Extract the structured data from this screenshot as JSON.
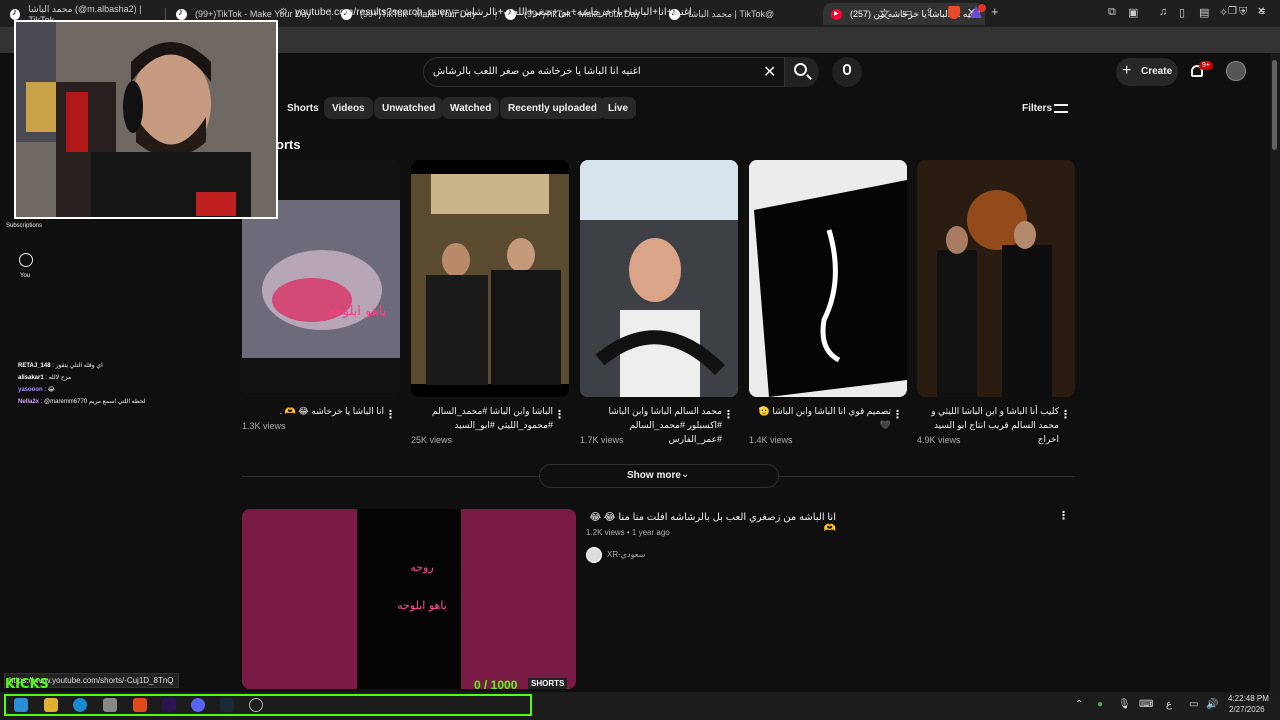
{
  "browser": {
    "tabs": [
      {
        "label": "محمد الباشا (@m.albasha2) | TikTok",
        "icon": "tiktok-icon"
      },
      {
        "label": "(99+)TikTok - Make Your Day",
        "icon": "tiktok-icon"
      },
      {
        "label": "(99+)TikTok - Make Your Day",
        "icon": "tiktok-icon"
      },
      {
        "label": "(99+)TikTok - Make Your Day",
        "icon": "tiktok-icon"
      },
      {
        "label": "محمد الباشا | TikTok@",
        "icon": "tiktok-icon"
      },
      {
        "label": "(257) اغنيه انا الباشا يا خرخاشه من",
        "icon": "youtube-icon",
        "active": true
      }
    ],
    "url": "youtube.com/results?search_query=اغنيه+انا+الباشا+يا+خرخاشه+من+صغر+اللعب+بالرشاش",
    "window_controls": [
      "─",
      "❐",
      "✕"
    ]
  },
  "youtube": {
    "search": {
      "value": "اغنيه انا الباشا يا خرخاشه من صغر اللعب بالرشاش"
    },
    "create_label": "Create",
    "notif_badge": "9+",
    "chips": [
      "Shorts",
      "Videos",
      "Unwatched",
      "Watched",
      "Recently uploaded",
      "Live"
    ],
    "filters_label": "Filters",
    "shorts_heading": "orts",
    "shorts": [
      {
        "title": "انا الباشا يا خرخاشه 😂 🫶 .",
        "views": "1.3K views"
      },
      {
        "title": "الباشا وابن الباشا #محمد_السالم #محمود_الليثي #ابو_السيد",
        "views": "25K views"
      },
      {
        "title": "محمد السالم الباشا وابن الباشا #اكسبلور #محمد_السالم #عمر_الفارس",
        "views": "1.7K views"
      },
      {
        "title": "تصميم قوي انا الباشا وابن الباشا 🫡🖤",
        "views": "1.4K views"
      },
      {
        "title": "كليب أنا الباشا و ابن الباشا الليثي و محمد السالم قريب انتاج ابو السيد اخراج",
        "views": "4.9K views"
      }
    ],
    "show_more": "Show more",
    "video": {
      "title": "انا الباشه من زصغري العب بل بالرشاشه افلت منا منا 😂 😂 🫶",
      "meta": "1.2K views • 1 year ago",
      "channel": "XR-سعودي",
      "thumb_text_top": "روحه",
      "thumb_text_mid": "ياهو ابلوحه"
    },
    "short_overlay_text": "ياهو ابلوحه",
    "sidebar": {
      "subscriptions": "Subscriptions",
      "you": "You"
    }
  },
  "chat": [
    {
      "user": "RETAJ_148",
      "msg": "اي وقله التلي يتقوز",
      "color": "#ffffff"
    },
    {
      "user": "alisakar1",
      "msg": "مزح لالله",
      "color": "#ffffff"
    },
    {
      "user": "yasooon",
      "msg": "😂",
      "color": "#a58cff"
    },
    {
      "user": "Nella2x",
      "msg": "@maremm6770 لحظه اللتي اسمع مريم",
      "color": "#d9a0ff"
    }
  ],
  "overlay": {
    "status_url": "https://www.youtube.com/shorts/-Cuj1D_8TnQ",
    "kicks_label": "KICKS",
    "kicks_count": "0 / 1000",
    "shorts_badge": "SHORTS"
  },
  "taskbar": {
    "time": "4:22:48 PM",
    "date": "2/27/2026",
    "lang": "ع"
  },
  "colors": {
    "accent_green": "#53fc18",
    "yt_red": "#ff0033",
    "bg": "#0f0f0f"
  }
}
